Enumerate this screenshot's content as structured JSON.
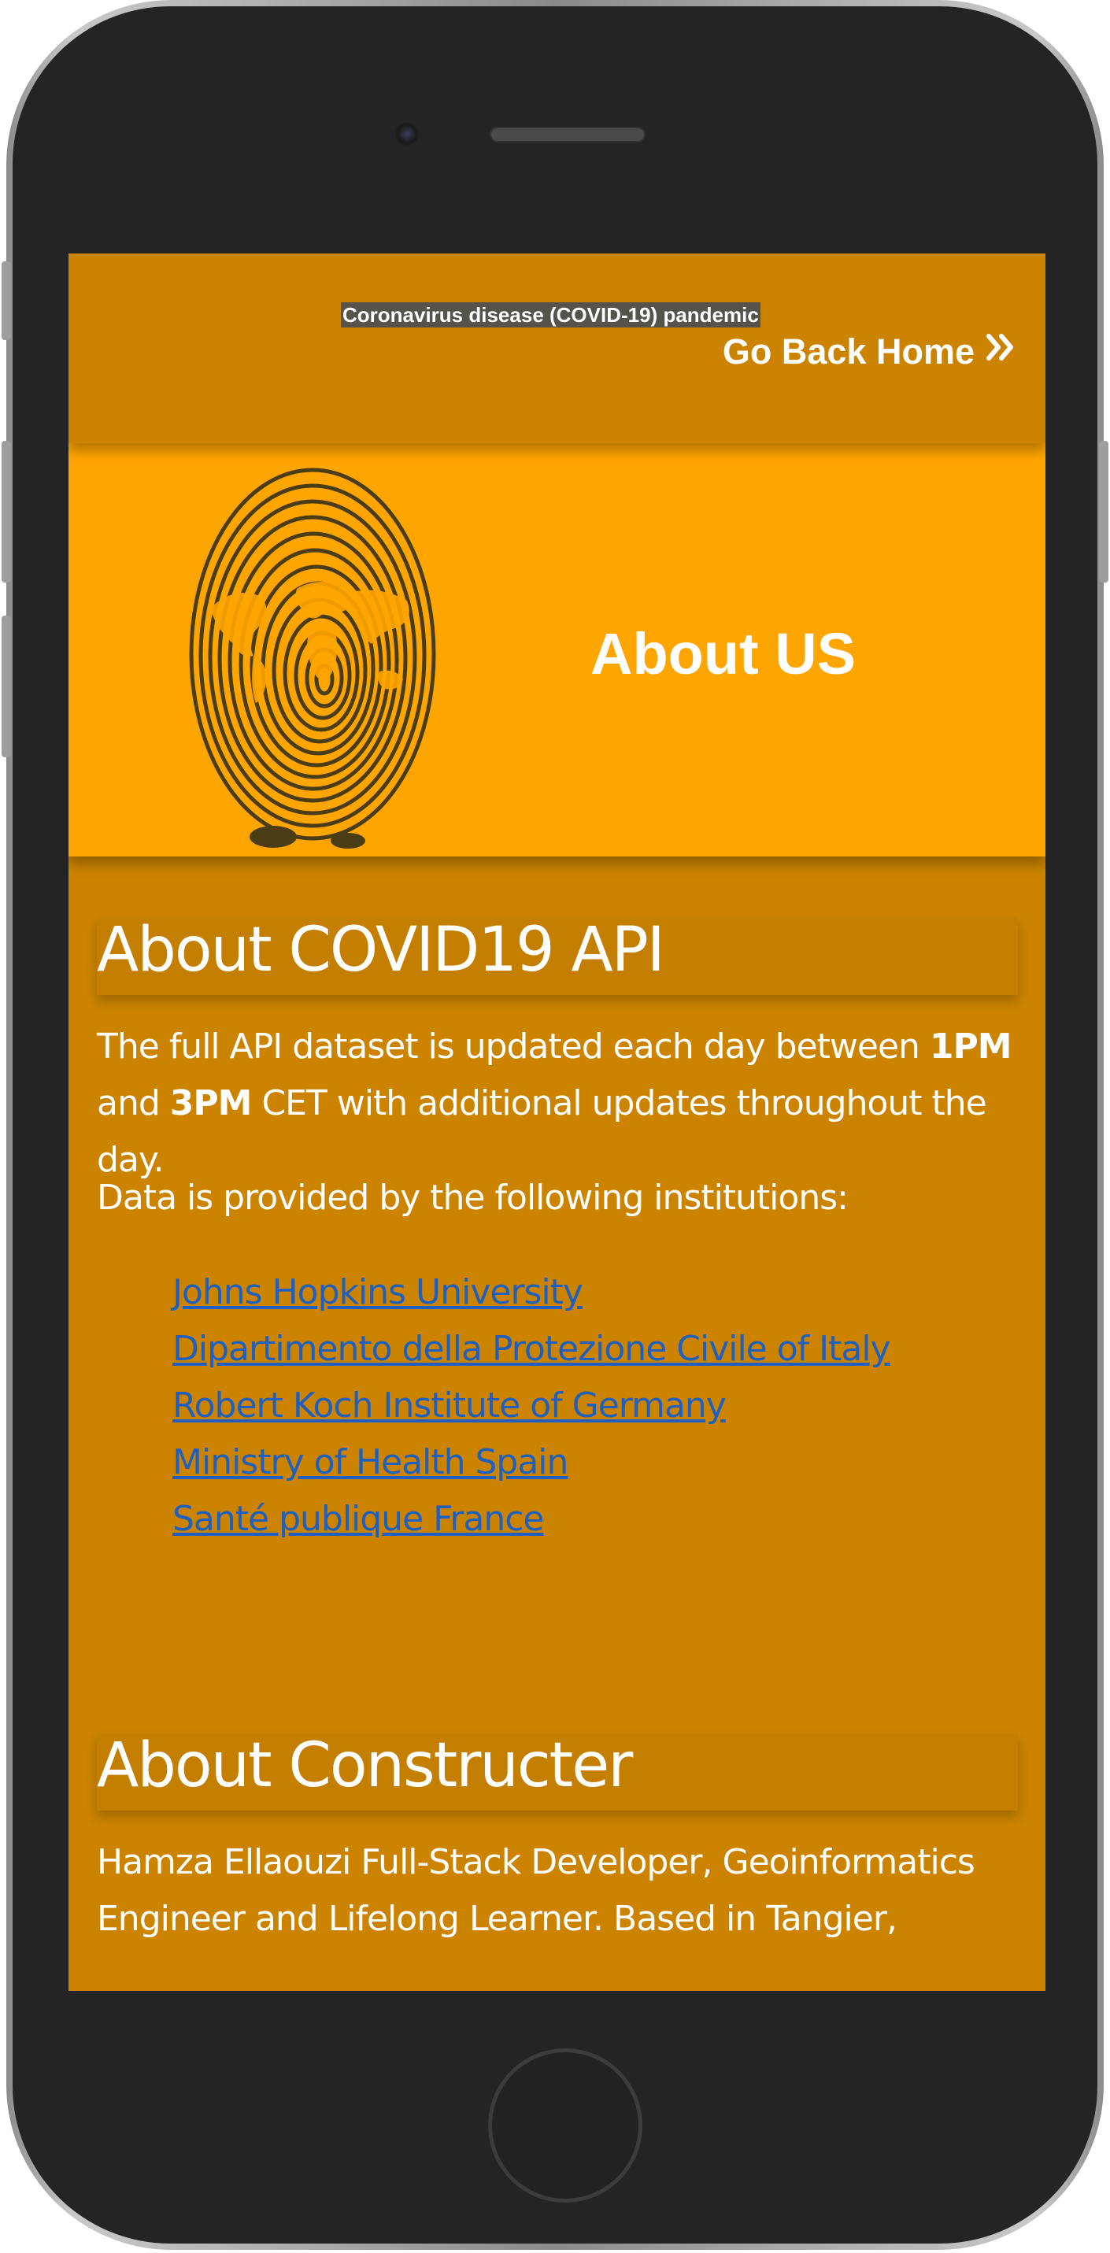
{
  "header": {
    "site_title": "Coronavirus disease (COVID-19) pandemic",
    "home_link": "Go Back Home",
    "home_link_icon": "double-chevron-right-icon"
  },
  "banner": {
    "title": "About US",
    "image": "fingerprint-world-map-image"
  },
  "api_section": {
    "heading": "About COVID19 API",
    "update_text_1": "The full API dataset is updated each day between ",
    "update_time_1": "1PM",
    "update_text_2": " and ",
    "update_time_2": "3PM",
    "update_text_3": " CET with additional updates throughout the day.",
    "sources_intro": "Data is provided by the following institutions:",
    "institutions": [
      "Johns Hopkins University",
      "Dipartimento della Protezione Civile of Italy",
      "Robert Koch Institute of Germany",
      "Ministry of Health Spain",
      "Santé publique France"
    ]
  },
  "constructor_section": {
    "heading": "About Constructer",
    "bio": "Hamza Ellaouzi Full-Stack Developer, Geoinformatics Engineer and Lifelong Learner. Based in Tangier,"
  },
  "colors": {
    "page_bg": "#cc8400",
    "banner_bg": "#ffa500",
    "link": "#1f5fbf",
    "text": "#ffffff"
  }
}
